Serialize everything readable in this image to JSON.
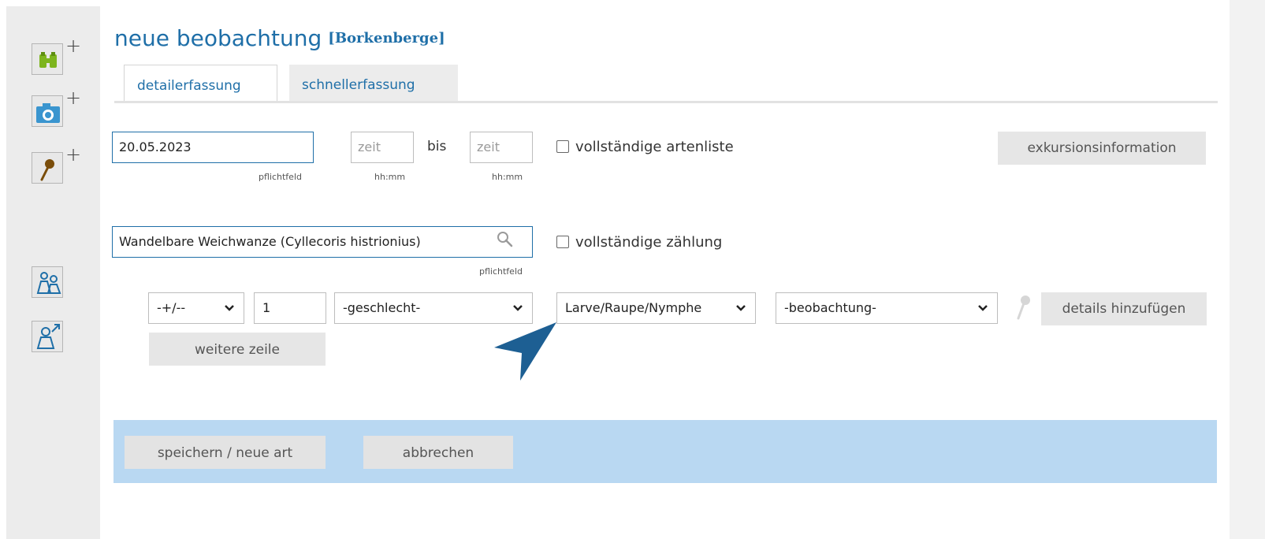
{
  "sidebar": {
    "buttons": [
      {
        "name": "binoculars-add",
        "icon": "binoculars-icon",
        "plus": "+"
      },
      {
        "name": "camera-add",
        "icon": "camera-icon",
        "plus": "+"
      },
      {
        "name": "pin-add",
        "icon": "pin-icon",
        "plus": "+"
      },
      {
        "name": "people",
        "icon": "people-icon"
      },
      {
        "name": "person-share",
        "icon": "person-arrow-icon"
      }
    ]
  },
  "header": {
    "title": "neue beobachtung",
    "site": "[Borkenberge]"
  },
  "tabs": [
    {
      "label": "detailerfassung",
      "active": true
    },
    {
      "label": "schnellerfassung",
      "active": false
    }
  ],
  "form": {
    "date_value": "20.05.2023",
    "date_hint": "pflichtfeld",
    "time_from_placeholder": "zeit",
    "time_from_hint": "hh:mm",
    "bis_label": "bis",
    "time_to_placeholder": "zeit",
    "time_to_hint": "hh:mm",
    "complete_list_label": "vollständige artenliste",
    "excursion_button": "exkursionsinformation",
    "species_value": "Wandelbare Weichwanze (Cyllecoris histrionius)",
    "species_hint": "pflichtfeld",
    "complete_count_label": "vollständige zählung",
    "accuracy_select": "-+/--",
    "count_value": "1",
    "sex_select": "-geschlecht-",
    "stage_select": "Larve/Raupe/Nymphe",
    "observation_select": "-beobachtung-",
    "add_details_button": "details hinzufügen",
    "add_row_button": "weitere zeile"
  },
  "actions": {
    "save_button": "speichern / neue art",
    "cancel_button": "abbrechen"
  },
  "colors": {
    "accent": "#1f6fa8",
    "save_band": "#b9d8f2",
    "sidebar_bg": "#ececec"
  }
}
